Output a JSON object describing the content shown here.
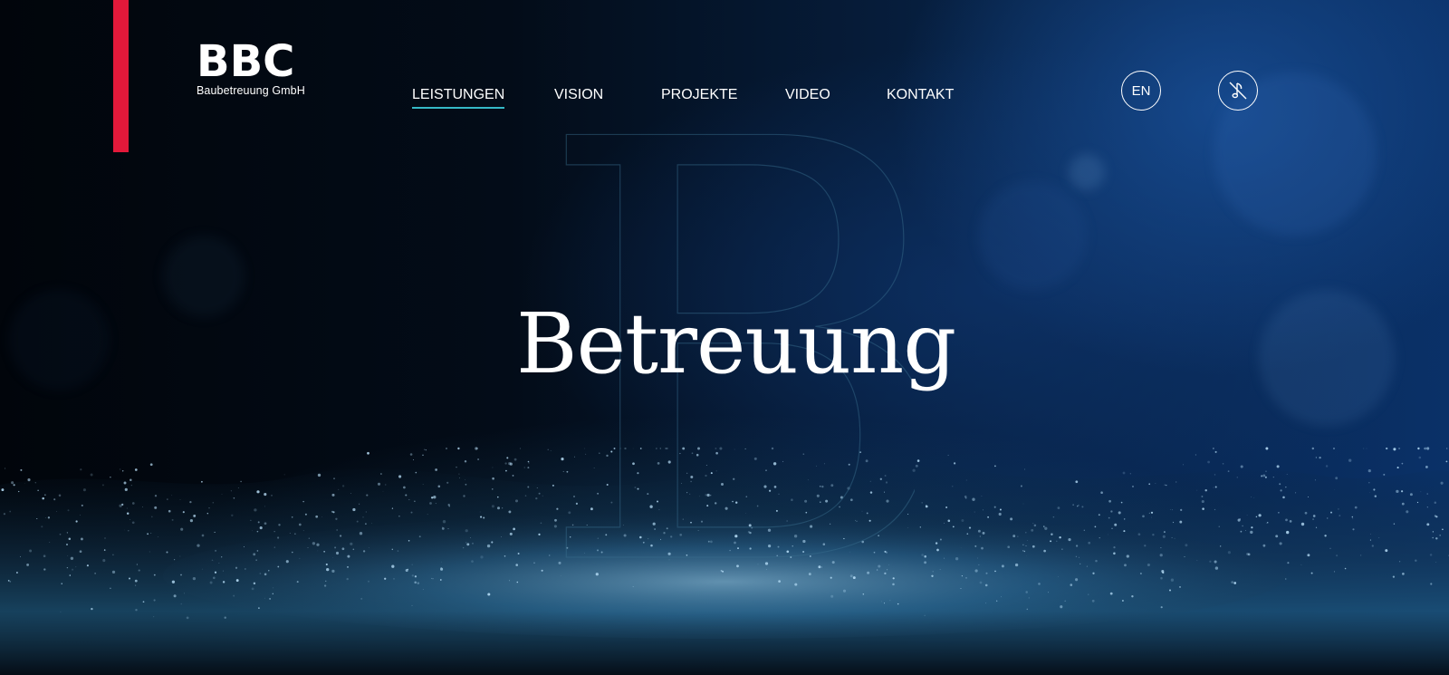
{
  "brand": {
    "logo": "BBC",
    "subtitle": "Baubetreuung GmbH",
    "accent_color": "#e3193a"
  },
  "nav": {
    "items": [
      {
        "label": "LEISTUNGEN",
        "active": true
      },
      {
        "label": "VISION",
        "active": false
      },
      {
        "label": "PROJEKTE",
        "active": false
      },
      {
        "label": "VIDEO",
        "active": false
      },
      {
        "label": "KONTAKT",
        "active": false
      }
    ],
    "active_underline_color": "#35b9c7"
  },
  "controls": {
    "language_label": "EN",
    "sound_icon": "music-note-muted-icon"
  },
  "hero": {
    "title": "Betreuung",
    "background_letter": "B"
  }
}
